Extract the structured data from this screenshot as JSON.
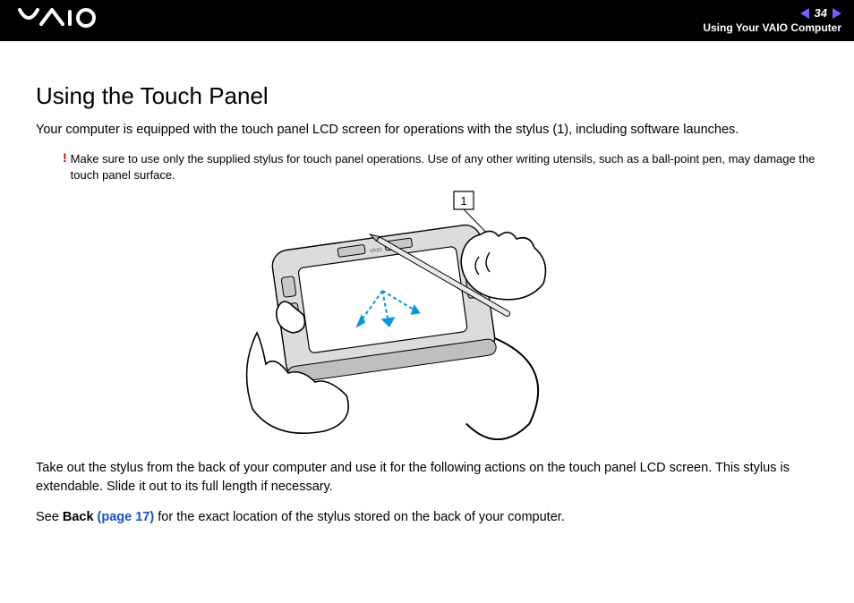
{
  "header": {
    "logo_text": "VAIO",
    "page_number": "34",
    "section": "Using Your VAIO Computer"
  },
  "title": "Using the Touch Panel",
  "intro": "Your computer is equipped with the touch panel LCD screen for operations with the stylus (1), including software launches.",
  "warning": {
    "mark": "!",
    "text": "Make sure to use only the supplied stylus for touch panel operations. Use of any other writing utensils, such as a ball-point pen, may damage the touch panel surface."
  },
  "figure": {
    "callout_label": "1"
  },
  "body2": "Take out the stylus from the back of your computer and use it for the following actions on the touch panel LCD screen. This stylus is extendable. Slide it out to its full length if necessary.",
  "see_line": {
    "prefix": "See ",
    "bold": "Back ",
    "link": "(page 17)",
    "suffix": " for the exact location of the stylus stored on the back of your computer."
  }
}
